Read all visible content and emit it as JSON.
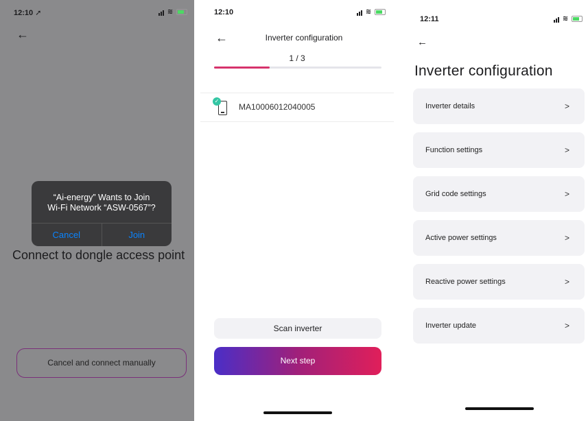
{
  "screen1": {
    "time": "12:10 ➚",
    "back_icon": "arrow-left-icon",
    "alert": {
      "line1": "“Ai-energy” Wants to Join",
      "line2": "Wi-Fi Network “ASW-0567”?",
      "cancel": "Cancel",
      "join": "Join"
    },
    "heading": "Connect to dongle access point",
    "manual_button": "Cancel and connect manually"
  },
  "screen2": {
    "time": "12:10",
    "title": "Inverter configuration",
    "step": "1 / 3",
    "progress": 0.333,
    "device": "MA10006012040005",
    "scan_button": "Scan inverter",
    "next_button": "Next step"
  },
  "screen3": {
    "time": "12:11",
    "title": "Inverter configuration",
    "items": [
      {
        "label": "Inverter details"
      },
      {
        "label": "Function settings"
      },
      {
        "label": "Grid code settings"
      },
      {
        "label": "Active power settings"
      },
      {
        "label": "Reactive power settings"
      },
      {
        "label": "Inverter update"
      }
    ],
    "chevron": ">"
  }
}
